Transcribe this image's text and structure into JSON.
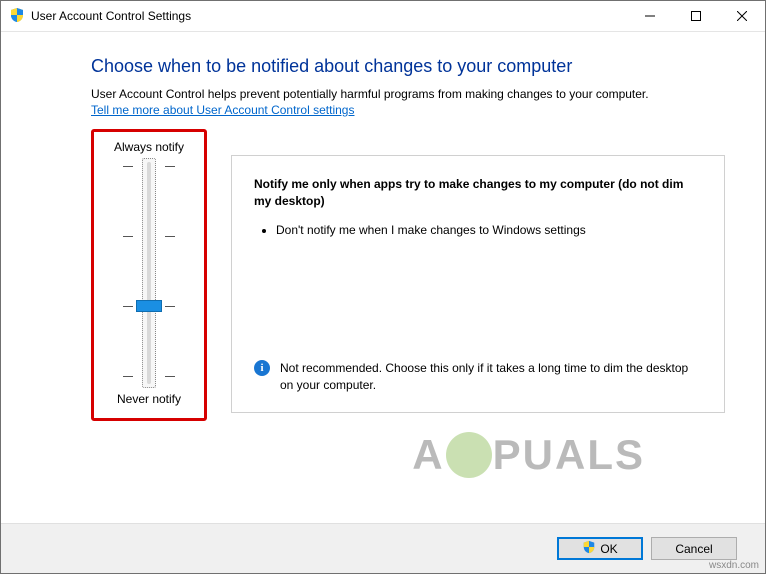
{
  "window": {
    "title": "User Account Control Settings"
  },
  "main": {
    "heading": "Choose when to be notified about changes to your computer",
    "subtext": "User Account Control helps prevent potentially harmful programs from making changes to your computer.",
    "help_link": "Tell me more about User Account Control settings"
  },
  "slider": {
    "top_label": "Always notify",
    "bottom_label": "Never notify",
    "levels": 4,
    "current_level_index": 2
  },
  "description": {
    "title": "Notify me only when apps try to make changes to my computer (do not dim my desktop)",
    "bullets": [
      "Don't notify me when I make changes to Windows settings"
    ],
    "note": "Not recommended. Choose this only if it takes a long time to dim the desktop on your computer."
  },
  "footer": {
    "ok_label": "OK",
    "cancel_label": "Cancel"
  },
  "watermark": {
    "pre": "A",
    "post": "PUALS",
    "attribution": "wsxdn.com"
  }
}
